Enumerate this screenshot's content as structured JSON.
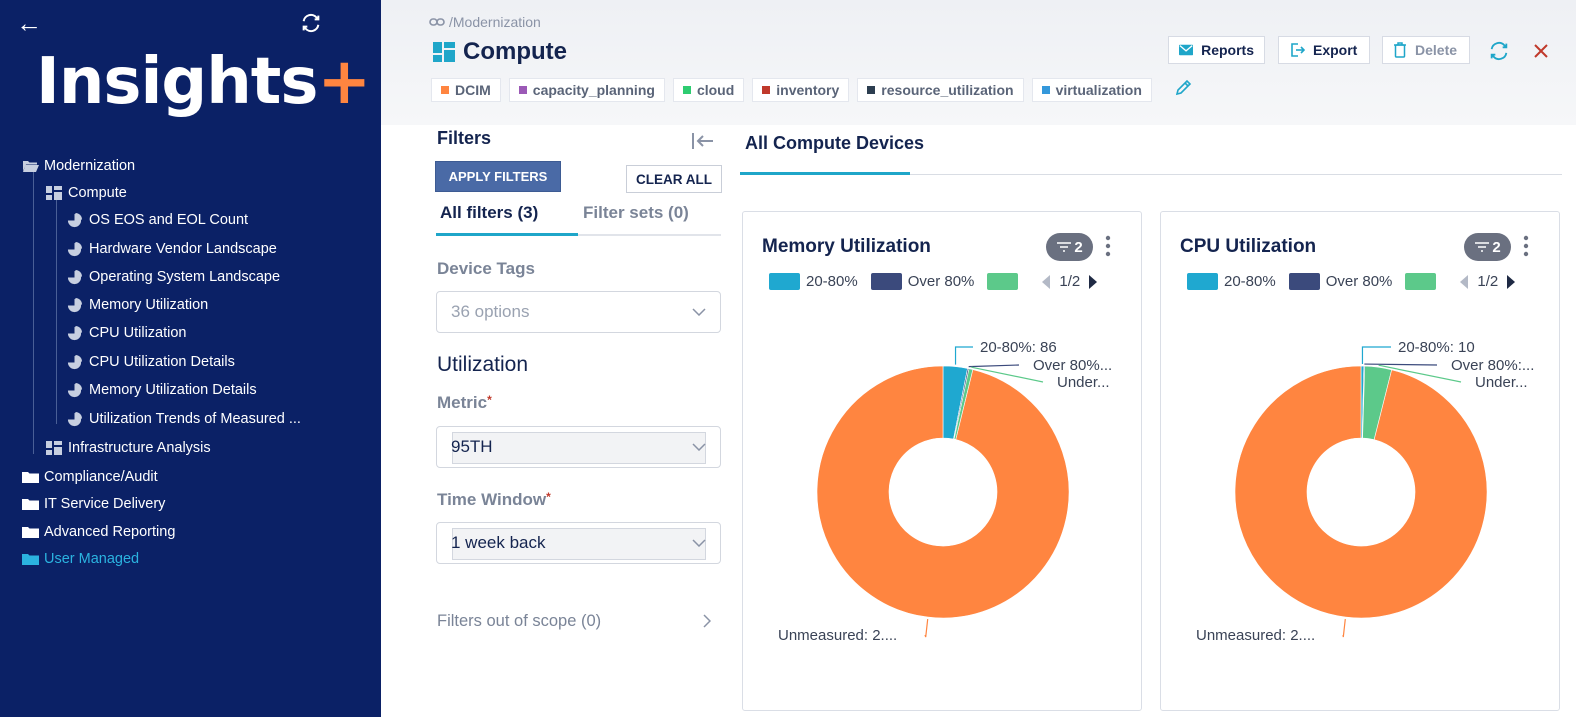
{
  "sidebar": {
    "logo_text": "Insights",
    "logo_plus": "+",
    "tree": [
      {
        "label": "Modernization",
        "icon": "folder-open-icon"
      },
      {
        "label": "Compute",
        "icon": "dashboard-icon"
      },
      {
        "label": "OS EOS and EOL Count",
        "icon": "pie-chart-icon"
      },
      {
        "label": "Hardware Vendor Landscape",
        "icon": "pie-chart-icon"
      },
      {
        "label": "Operating System Landscape",
        "icon": "pie-chart-icon"
      },
      {
        "label": "Memory Utilization",
        "icon": "pie-chart-icon"
      },
      {
        "label": "CPU Utilization",
        "icon": "pie-chart-icon"
      },
      {
        "label": "CPU Utilization Details",
        "icon": "pie-chart-icon"
      },
      {
        "label": "Memory Utilization Details",
        "icon": "pie-chart-icon"
      },
      {
        "label": "Utilization Trends of Measured ...",
        "icon": "pie-chart-icon"
      },
      {
        "label": "Infrastructure Analysis",
        "icon": "dashboard-icon"
      },
      {
        "label": "Compliance/Audit",
        "icon": "folder-icon"
      },
      {
        "label": "IT Service Delivery",
        "icon": "folder-icon"
      },
      {
        "label": "Advanced Reporting",
        "icon": "folder-icon"
      },
      {
        "label": "User Managed",
        "icon": "folder-icon"
      }
    ]
  },
  "header": {
    "breadcrumb": "/Modernization",
    "title": "Compute",
    "tags": [
      {
        "label": "DCIM",
        "color": "#ff8540"
      },
      {
        "label": "capacity_planning",
        "color": "#9b59b6"
      },
      {
        "label": "cloud",
        "color": "#2ecc71"
      },
      {
        "label": "inventory",
        "color": "#c0392b"
      },
      {
        "label": "resource_utilization",
        "color": "#2c3e50"
      },
      {
        "label": "virtualization",
        "color": "#3498db"
      }
    ],
    "reports_label": "Reports",
    "export_label": "Export",
    "delete_label": "Delete"
  },
  "filters": {
    "title": "Filters",
    "apply_label": "APPLY FILTERS",
    "clear_label": "CLEAR ALL",
    "tab_all": "All filters (3)",
    "tab_sets": "Filter sets (0)",
    "device_tags_label": "Device Tags",
    "device_tags_placeholder": "36 options",
    "utilization_title": "Utilization",
    "metric_label": "Metric",
    "metric_value": "95TH",
    "time_window_label": "Time Window",
    "time_window_value": "1 week back",
    "required_mark": "*",
    "out_of_scope": "Filters out of scope (0)"
  },
  "dashboard": {
    "tab_label": "All Compute Devices"
  },
  "chart_data": [
    {
      "type": "pie",
      "title": "Memory Utilization",
      "filter_count": "2",
      "legend": [
        "20-80%",
        "Over 80%",
        ""
      ],
      "legend_colors": [
        "#1fa8d0",
        "#3b4a7c",
        "#5cc98a"
      ],
      "pager": "1/2",
      "slices": [
        {
          "label": "20-80%",
          "value": 86,
          "color": "#1fa8d0",
          "callout": "20-80%: 86"
        },
        {
          "label": "Over 80%",
          "value": 5,
          "color": "#3b4a7c",
          "callout": "Over 80%..."
        },
        {
          "label": "Under",
          "value": 14,
          "color": "#5cc98a",
          "callout": "Under..."
        },
        {
          "label": "Unmeasured",
          "value": 2650,
          "color": "#ff8540",
          "callout": "Unmeasured: 2...."
        }
      ]
    },
    {
      "type": "pie",
      "title": "CPU Utilization",
      "filter_count": "2",
      "legend": [
        "20-80%",
        "Over 80%",
        ""
      ],
      "legend_colors": [
        "#1fa8d0",
        "#3b4a7c",
        "#5cc98a"
      ],
      "pager": "1/2",
      "slices": [
        {
          "label": "20-80%",
          "value": 10,
          "color": "#1fa8d0",
          "callout": "20-80%: 10"
        },
        {
          "label": "Over 80%",
          "value": 3,
          "color": "#3b4a7c",
          "callout": "Over 80%:..."
        },
        {
          "label": "Under",
          "value": 95,
          "color": "#5cc98a",
          "callout": "Under..."
        },
        {
          "label": "Unmeasured",
          "value": 2650,
          "color": "#ff8540",
          "callout": "Unmeasured: 2...."
        }
      ]
    }
  ]
}
